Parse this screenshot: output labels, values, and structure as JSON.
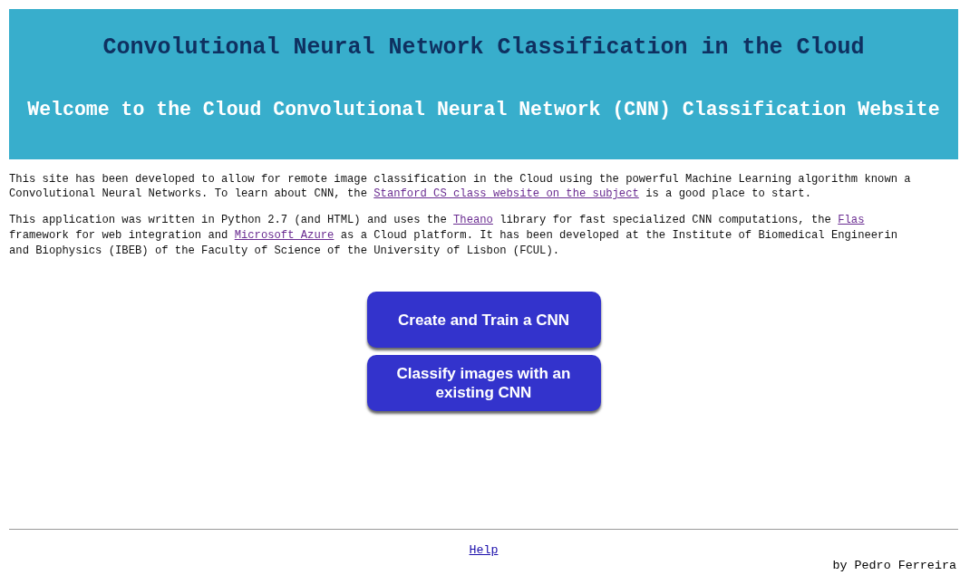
{
  "header": {
    "title": "Convolutional Neural Network Classification in the Cloud",
    "subtitle": "Welcome to the Cloud Convolutional Neural Network (CNN) Classification Website"
  },
  "paragraphs": [
    [
      [
        {
          "text": "This site has been developed to allow for remote image classification in the Cloud using the powerful Machine Learning algorithm known a"
        }
      ],
      [
        {
          "text": "Convolutional Neural Networks. To learn about CNN, the "
        },
        {
          "text": "Stanford CS class website on the subject",
          "kind": "link"
        },
        {
          "text": " is a good place to start."
        }
      ]
    ],
    [
      [
        {
          "text": "This application was written in Python 2.7 (and HTML) and uses the "
        },
        {
          "text": "Theano",
          "kind": "link"
        },
        {
          "text": " library for fast specialized CNN computations, the "
        },
        {
          "text": "Flas",
          "kind": "link"
        }
      ],
      [
        {
          "text": "framework for web integration and "
        },
        {
          "text": "Microsoft Azure",
          "kind": "link"
        },
        {
          "text": " as a Cloud platform. It has been developed at the Institute of Biomedical Engineerin"
        }
      ],
      [
        {
          "text": "and Biophysics (IBEB) of the Faculty of Science of the University of Lisbon (FCUL)."
        }
      ]
    ]
  ],
  "buttons": [
    "Create and Train a CNN",
    "Classify images with an existing CNN"
  ],
  "footer": {
    "help_link": "Help",
    "credit": "by Pedro Ferreira"
  }
}
